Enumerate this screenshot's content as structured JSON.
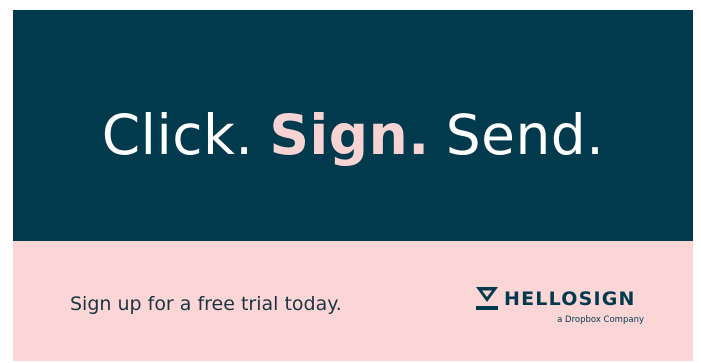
{
  "banner": {
    "headline": {
      "word1": "Click.",
      "word2": "Sign.",
      "word3": "Send."
    },
    "cta_text": "Sign up for a free trial today.",
    "logo": {
      "icon": "hellosign-checkmark-icon",
      "wordmark": "HELLOSIGN",
      "tagline": "a Dropbox Company"
    },
    "colors": {
      "hero_background": "#013a4d",
      "footer_background": "#fcd6d6",
      "accent_pink": "#f8d3d4",
      "text_dark": "#1a3540"
    }
  }
}
